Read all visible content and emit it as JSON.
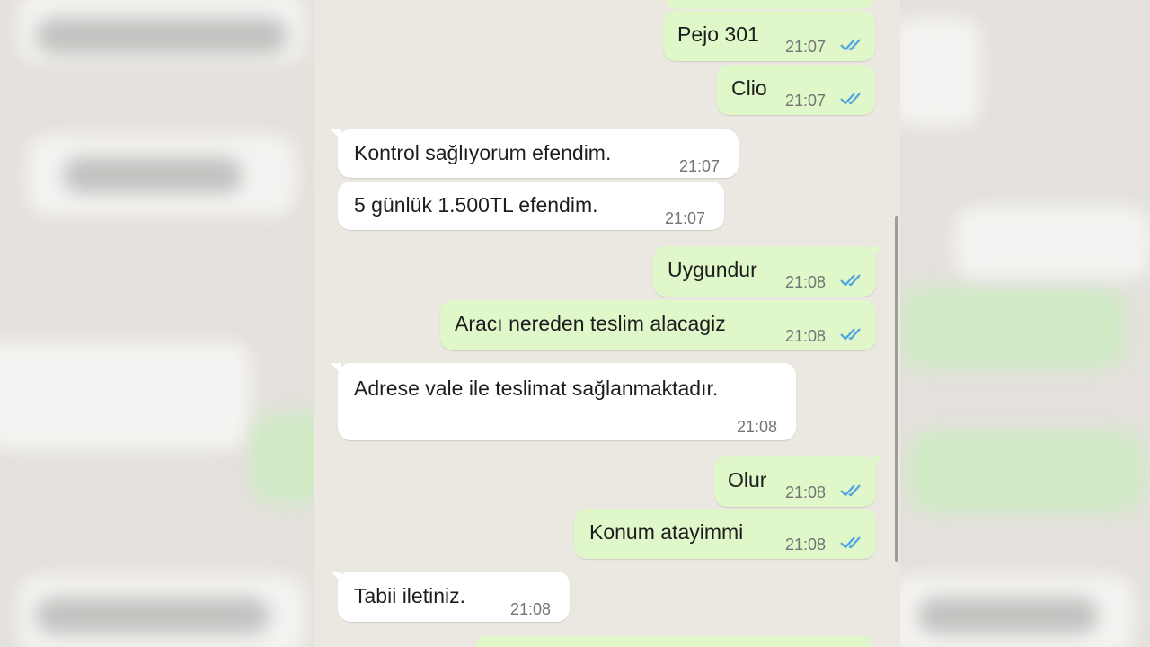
{
  "chat": {
    "messages": [
      {
        "id": "m1",
        "direction": "out",
        "text": "Pejo 301",
        "time": "21:07",
        "status": "read"
      },
      {
        "id": "m2",
        "direction": "out",
        "text": "Clio",
        "time": "21:07",
        "status": "read"
      },
      {
        "id": "m3",
        "direction": "in",
        "text": "Kontrol sağlıyorum efendim.",
        "time": "21:07"
      },
      {
        "id": "m4",
        "direction": "in",
        "text": "5 günlük 1.500TL efendim.",
        "time": "21:07"
      },
      {
        "id": "m5",
        "direction": "out",
        "text": "Uygundur",
        "time": "21:08",
        "status": "read"
      },
      {
        "id": "m6",
        "direction": "out",
        "text": "Aracı nereden teslim alacagiz",
        "time": "21:08",
        "status": "read"
      },
      {
        "id": "m7",
        "direction": "in",
        "text": "Adrese vale ile teslimat sağlanmaktadır.",
        "time": "21:08"
      },
      {
        "id": "m8",
        "direction": "out",
        "text": "Olur",
        "time": "21:08",
        "status": "read"
      },
      {
        "id": "m9",
        "direction": "out",
        "text": "Konum atayimmi",
        "time": "21:08",
        "status": "read"
      },
      {
        "id": "m10",
        "direction": "in",
        "text": "Tabii iletiniz.",
        "time": "21:08"
      }
    ]
  },
  "colors": {
    "outgoing_bubble": "#dff7c9",
    "incoming_bubble": "#ffffff",
    "chat_background": "#ebe7e1",
    "read_ticks": "#4fa3e0"
  },
  "icons": {
    "read_receipt": "double-check-icon"
  }
}
